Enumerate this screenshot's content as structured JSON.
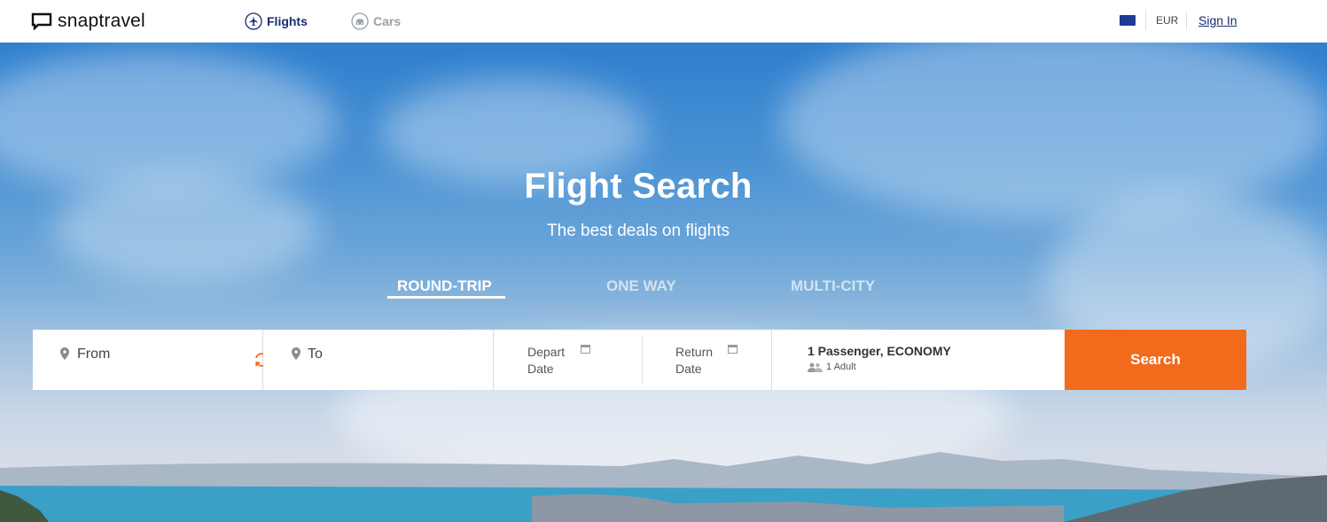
{
  "brand": {
    "name": "snaptravel"
  },
  "nav": {
    "flights_label": "Flights",
    "cars_label": "Cars",
    "currency": "EUR",
    "signin_label": "Sign In"
  },
  "hero": {
    "title": "Flight Search",
    "subtitle": "The best deals on flights"
  },
  "trip_tabs": [
    {
      "label": "ROUND-TRIP",
      "active": true
    },
    {
      "label": "ONE WAY",
      "active": false
    },
    {
      "label": "MULTI-CITY",
      "active": false
    }
  ],
  "search_form": {
    "from_placeholder": "From",
    "to_placeholder": "To",
    "depart_label_1": "Depart",
    "depart_label_2": "Date",
    "return_label_1": "Return",
    "return_label_2": "Date",
    "passengers_summary": "1 Passenger, ECONOMY",
    "passengers_detail": "1 Adult",
    "search_label": "Search"
  },
  "colors": {
    "accent": "#f26a1b",
    "brand_navy": "#1a2d6e",
    "flag_blue": "#1f3a93"
  },
  "icons": [
    "logo-mark-icon",
    "airplane-icon",
    "car-icon",
    "flag-icon",
    "location-pin-icon",
    "swap-icon",
    "calendar-icon",
    "users-icon"
  ]
}
